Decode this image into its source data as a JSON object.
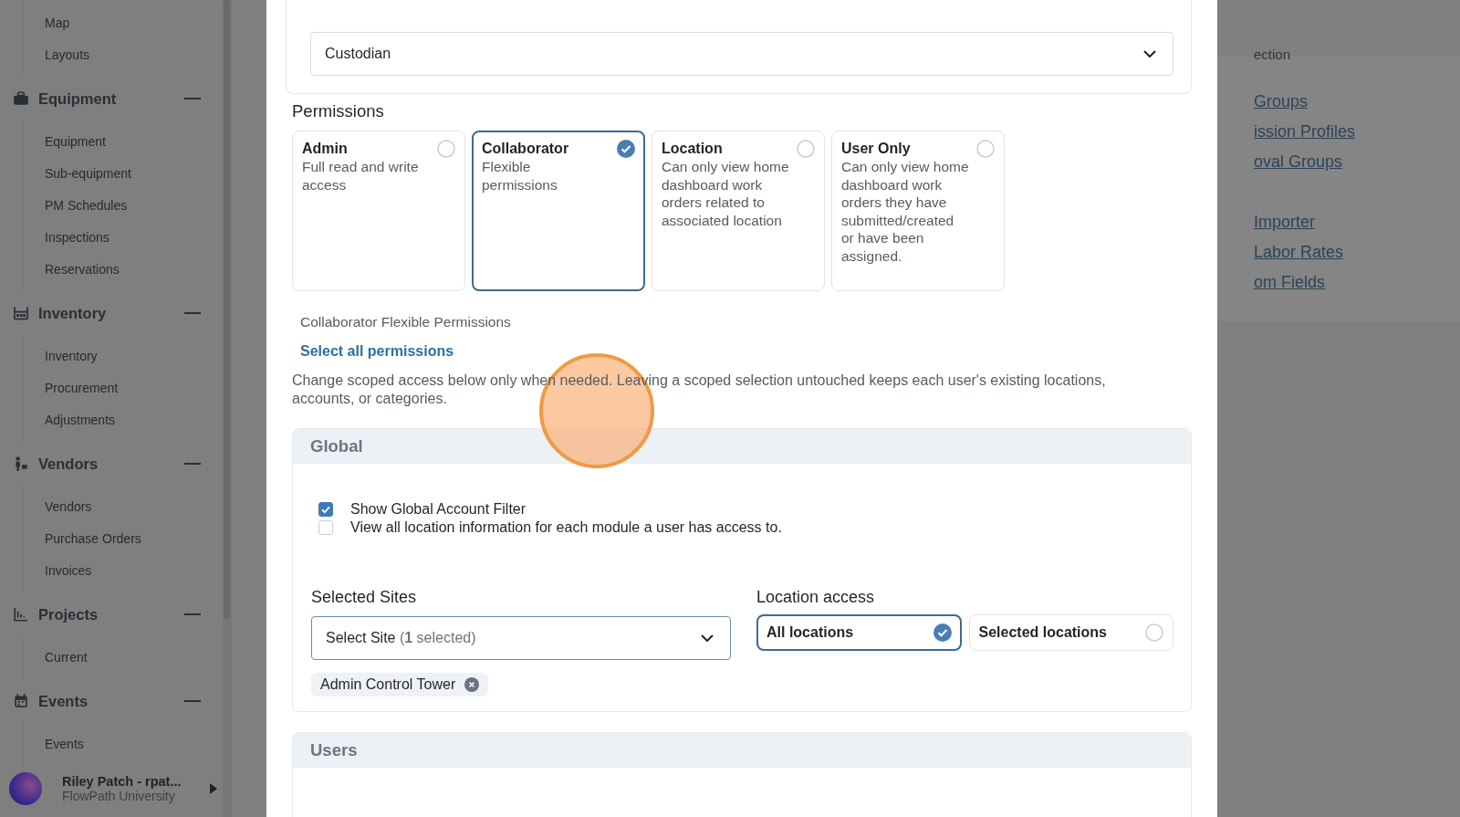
{
  "sidebar": {
    "top_items": [
      "Map",
      "Layouts"
    ],
    "sections": [
      {
        "title": "Equipment",
        "expanded": true,
        "items": [
          "Equipment",
          "Sub-equipment",
          "PM Schedules",
          "Inspections",
          "Reservations"
        ]
      },
      {
        "title": "Inventory",
        "expanded": true,
        "items": [
          "Inventory",
          "Procurement",
          "Adjustments"
        ]
      },
      {
        "title": "Vendors",
        "expanded": true,
        "items": [
          "Vendors",
          "Purchase Orders",
          "Invoices"
        ]
      },
      {
        "title": "Projects",
        "expanded": true,
        "items": [
          "Current"
        ]
      },
      {
        "title": "Events",
        "expanded": true,
        "items": [
          "Events"
        ]
      }
    ],
    "user": {
      "name": "Riley Patch - rpat...",
      "org": "FlowPath University"
    }
  },
  "background_panel": {
    "heading": "ection",
    "links": [
      "Groups",
      "ission Profiles",
      "oval Groups",
      "Importer",
      "Labor Rates",
      "om Fields"
    ]
  },
  "modal": {
    "profile_select": {
      "value": "Custodian"
    },
    "permissions": {
      "heading": "Permissions",
      "options": [
        {
          "title": "Admin",
          "description": "Full read and write access",
          "selected": false
        },
        {
          "title": "Collaborator",
          "description": "Flexible permissions",
          "selected": true
        },
        {
          "title": "Location",
          "description": "Can only view home dashboard work orders related to associated location",
          "selected": false
        },
        {
          "title": "User Only",
          "description": "Can only view home dashboard work orders they have submitted/created or have been assigned.",
          "selected": false
        }
      ]
    },
    "flexible_heading": "Collaborator Flexible Permissions",
    "select_all_link": "Select all permissions",
    "note": "Change scoped access below only when needed. Leaving a scoped selection untouched keeps each user's existing locations, accounts, or categories.",
    "global": {
      "title": "Global",
      "checkboxes": [
        {
          "label": "Show Global Account Filter",
          "checked": true
        },
        {
          "label": "View all location information for each module a user has access to.",
          "checked": false
        }
      ],
      "sites": {
        "label": "Selected Sites",
        "value": "Select Site",
        "count_note": "(**1** selected)",
        "tags": [
          "Admin Control Tower"
        ]
      },
      "location_access": {
        "label": "Location access",
        "options": [
          {
            "label": "All locations",
            "selected": true
          },
          {
            "label": "Selected locations",
            "selected": false
          }
        ]
      }
    },
    "users": {
      "title": "Users"
    }
  }
}
